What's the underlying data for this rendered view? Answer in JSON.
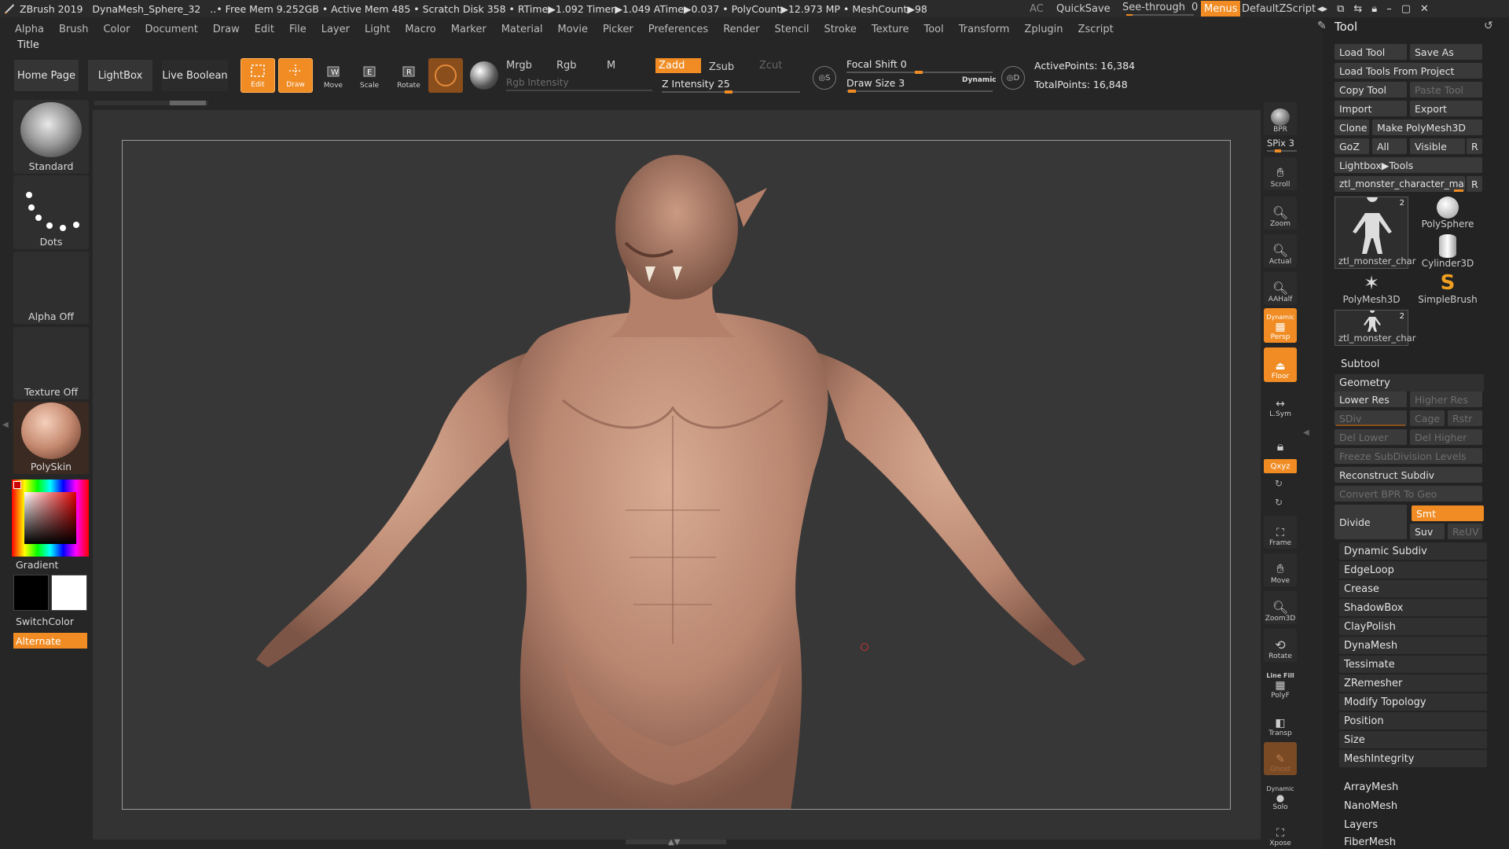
{
  "titlebar": {
    "app": "ZBrush 2019",
    "document": "DynaMesh_Sphere_32",
    "stats": "..• Free Mem 9.252GB • Active Mem 485 • Scratch Disk 358 • RTime▶1.092 Timer▶1.049 ATime▶0.037 • PolyCount▶12.973 MP • MeshCount▶98",
    "ac": "AC",
    "quicksave": "QuickSave",
    "see_through": "See-through",
    "see_through_value": "0",
    "menus": "Menus",
    "script": "DefaultZScript"
  },
  "menus": [
    "Alpha",
    "Brush",
    "Color",
    "Document",
    "Draw",
    "Edit",
    "File",
    "Layer",
    "Light",
    "Macro",
    "Marker",
    "Material",
    "Movie",
    "Picker",
    "Preferences",
    "Render",
    "Stencil",
    "Stroke",
    "Texture",
    "Tool",
    "Transform",
    "Zplugin",
    "Zscript"
  ],
  "title_label": "Title",
  "shelf": {
    "home_page": "Home Page",
    "lightbox": "LightBox",
    "live_boolean": "Live Boolean",
    "edit": "Edit",
    "draw": "Draw",
    "move": "Move",
    "scale": "Scale",
    "rotate": "Rotate",
    "mrgb": "Mrgb",
    "rgb": "Rgb",
    "m": "M",
    "zadd": "Zadd",
    "zsub": "Zsub",
    "zcut": "Zcut",
    "rgb_intensity": "Rgb Intensity",
    "z_intensity": "Z Intensity 25",
    "focal_shift": "Focal Shift 0",
    "draw_size": "Draw Size 3",
    "dynamic": "Dynamic",
    "active_points": "ActivePoints: 16,384",
    "total_points": "TotalPoints: 16,848"
  },
  "left": {
    "brush": "Standard",
    "stroke": "Dots",
    "alpha": "Alpha Off",
    "texture": "Texture Off",
    "material": "PolySkin",
    "gradient": "Gradient",
    "switch_color": "SwitchColor",
    "alternate": "Alternate"
  },
  "side": {
    "bpr": "BPR",
    "spix": "SPix 3",
    "scroll": "Scroll",
    "zoom": "Zoom",
    "actual": "Actual",
    "aahalf": "AAHalf",
    "dynamic": "Dynamic",
    "persp": "Persp",
    "floor": "Floor",
    "lsym": "L.Sym",
    "xyz": "Qxyz",
    "frame": "Frame",
    "move": "Move",
    "zoom3d": "Zoom3D",
    "rotate": "Rotate",
    "linefill": "Line Fill",
    "polyf": "PolyF",
    "transp": "Transp",
    "ghost": "Ghost",
    "dynamic2": "Dynamic",
    "solo": "Solo",
    "xpose": "Xpose"
  },
  "tool": {
    "header": "Tool",
    "load_tool": "Load Tool",
    "save_as": "Save As",
    "load_from_project": "Load Tools From Project",
    "copy_tool": "Copy Tool",
    "paste_tool": "Paste Tool",
    "import": "Import",
    "export": "Export",
    "clone": "Clone",
    "make_polymesh": "Make PolyMesh3D",
    "goz": "GoZ",
    "all": "All",
    "visible": "Visible",
    "r": "R",
    "lightbox_tools": "Lightbox▶Tools",
    "current_tool": "ztl_monster_character_male_",
    "thumbs": [
      {
        "label": "ztl_monster_char",
        "badge": "2"
      },
      {
        "label": "PolySphere",
        "badge": ""
      },
      {
        "label": "Cylinder3D",
        "badge": ""
      },
      {
        "label": "PolyMesh3D",
        "badge": ""
      },
      {
        "label": "SimpleBrush",
        "badge": ""
      },
      {
        "label": "ztl_monster_char",
        "badge": "2"
      }
    ],
    "subtool": "Subtool",
    "geometry": "Geometry",
    "lower_res": "Lower Res",
    "higher_res": "Higher Res",
    "sdiv": "SDiv",
    "cage": "Cage",
    "rstr": "Rstr",
    "del_lower": "Del Lower",
    "del_higher": "Del Higher",
    "freeze": "Freeze SubDivision Levels",
    "reconstruct": "Reconstruct Subdiv",
    "convert_bpr": "Convert BPR To Geo",
    "divide": "Divide",
    "smt": "Smt",
    "suv": "Suv",
    "reuv": "ReUV",
    "sections": [
      "Dynamic Subdiv",
      "EdgeLoop",
      "Crease",
      "ShadowBox",
      "ClayPolish",
      "DynaMesh",
      "Tessimate",
      "ZRemesher",
      "Modify Topology",
      "Position",
      "Size",
      "MeshIntegrity"
    ],
    "lower_sections": [
      "ArrayMesh",
      "NanoMesh",
      "Layers",
      "FiberMesh"
    ]
  },
  "colors": {
    "accent": "#f08c23",
    "panel": "#2b2b2b",
    "canvas": "#333333",
    "skin": "#c99a80"
  }
}
